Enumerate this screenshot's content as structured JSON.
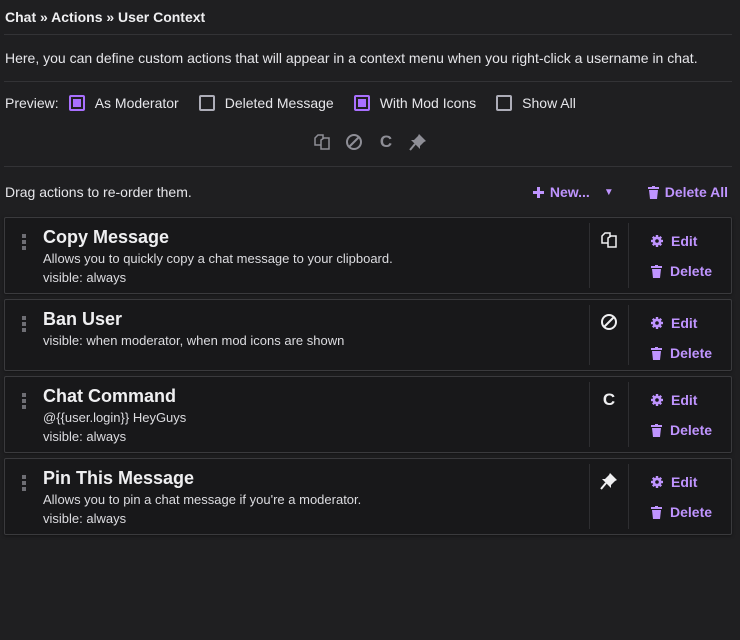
{
  "breadcrumb": "Chat » Actions » User Context",
  "description": "Here, you can define custom actions that will appear in a context menu when you right-click a username in chat.",
  "preview": {
    "label": "Preview:",
    "options": [
      {
        "label": "As Moderator",
        "checked": true
      },
      {
        "label": "Deleted Message",
        "checked": false
      },
      {
        "label": "With Mod Icons",
        "checked": true
      },
      {
        "label": "Show All",
        "checked": false
      }
    ],
    "icons": [
      "copy-icon",
      "ban-icon",
      "chat-command-icon",
      "pin-icon"
    ],
    "command_glyph": "C"
  },
  "toolbar": {
    "hint": "Drag actions to re-order them.",
    "new_label": "New...",
    "delete_all_label": "Delete All"
  },
  "colors": {
    "accent": "#bf94ff",
    "checkbox": "#a970ff",
    "background": "#1f1f21",
    "card": "#18181a"
  },
  "actions": [
    {
      "title": "Copy Message",
      "desc": "Allows you to quickly copy a chat message to your clipboard.",
      "visible": "visible: always",
      "icon": "copy-icon",
      "edit": "Edit",
      "delete": "Delete"
    },
    {
      "title": "Ban User",
      "desc": "",
      "visible": "visible: when moderator, when mod icons are shown",
      "icon": "ban-icon",
      "edit": "Edit",
      "delete": "Delete"
    },
    {
      "title": "Chat Command",
      "desc": "@{{user.login}} HeyGuys",
      "visible": "visible: always",
      "icon": "chat-command-icon",
      "glyph": "C",
      "edit": "Edit",
      "delete": "Delete"
    },
    {
      "title": "Pin This Message",
      "desc": "Allows you to pin a chat message if you're a moderator.",
      "visible": "visible: always",
      "icon": "pin-icon",
      "edit": "Edit",
      "delete": "Delete"
    }
  ]
}
